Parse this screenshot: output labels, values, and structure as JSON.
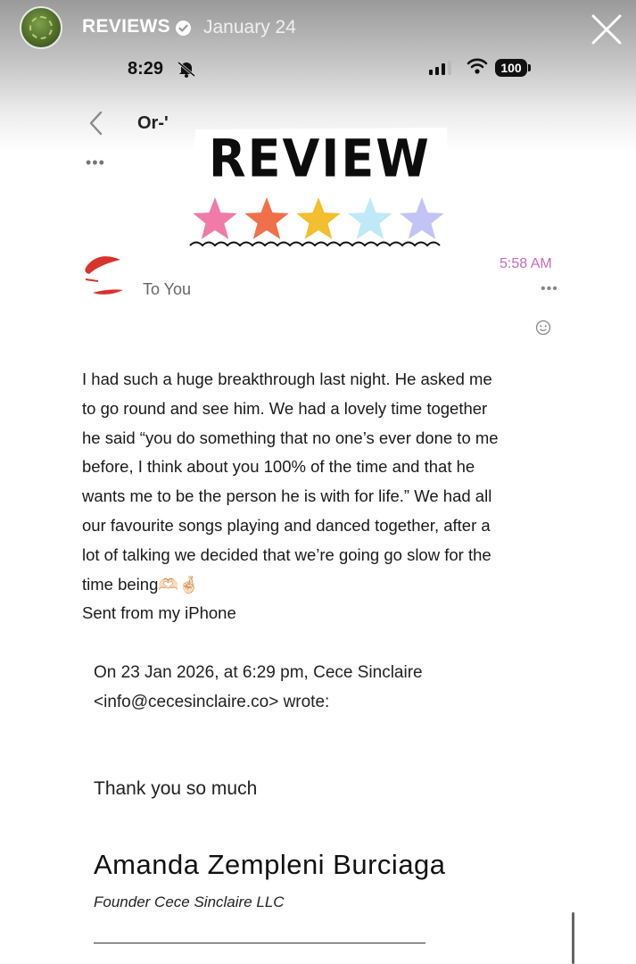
{
  "story": {
    "account_name": "REVIEWS",
    "date": "January 24"
  },
  "status_bar": {
    "time": "8:29",
    "battery": "100"
  },
  "mail_header": {
    "title_partial": "Or-'"
  },
  "sticker": {
    "text": "REVIEW",
    "stars": [
      "#f07aa8",
      "#f0704a",
      "#f2bf2e",
      "#bfe9f7",
      "#c3c4f5"
    ]
  },
  "message": {
    "time": "5:58 AM",
    "recipient": "To You",
    "body_lines": [
      "I had such a huge breakthrough last night. He asked me",
      "to go round and see him. We had a lovely time together",
      "he said “you do something that no one’s ever done to me",
      "before, I think about you 100% of the time and that he",
      "wants me to be the person he is with for life.” We had all",
      "our favourite songs playing and danced together, after a",
      "lot of talking we decided that we’re going go slow for the",
      "time being🫶🏻🤞🏻",
      "Sent from my iPhone"
    ],
    "quoted_header_line1": "On 23 Jan 2026, at 6:29 pm, Cece Sinclaire",
    "quoted_header_line2": "<info@cecesinclaire.co> wrote:",
    "quoted_body": "Thank you so much",
    "signature_name": "Amanda Zempleni Burciaga",
    "signature_title": "Founder Cece Sinclaire LLC"
  },
  "colors": {
    "time_accent": "#c66cb8",
    "sender_logo": "#d9332b"
  }
}
